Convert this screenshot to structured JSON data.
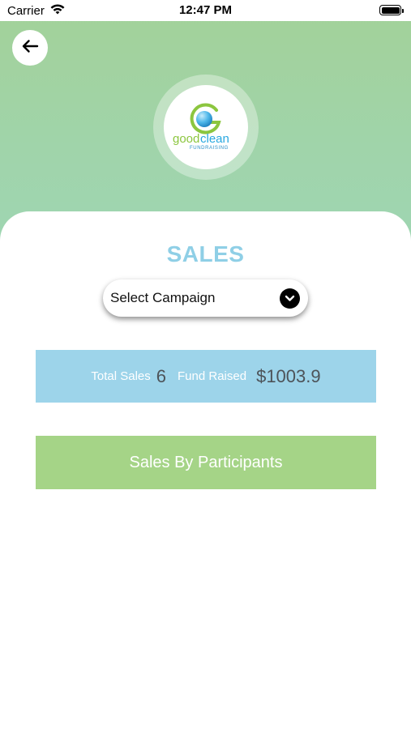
{
  "status_bar": {
    "carrier": "Carrier",
    "time": "12:47 PM"
  },
  "header": {
    "back_icon": "arrow-left-icon",
    "logo": {
      "word1": "good",
      "word2": "clean",
      "tagline": "FUNDRAISING",
      "primary_color": "#8cc63f",
      "accent_color": "#29a8e0"
    }
  },
  "main": {
    "title": "SALES",
    "campaign_select": {
      "selected": "Select Campaign",
      "icon": "chevron-down-icon"
    },
    "stats": {
      "total_sales_label": "Total Sales",
      "total_sales_value": "6",
      "fund_raised_label": "Fund Raised",
      "fund_raised_value": "$1003.9"
    },
    "participants_button_label": "Sales By Participants"
  },
  "colors": {
    "header_green": "#a3d198",
    "title_blue": "#8fcfe6",
    "stats_blue": "#9dd4ea",
    "button_green": "#a5d487"
  }
}
